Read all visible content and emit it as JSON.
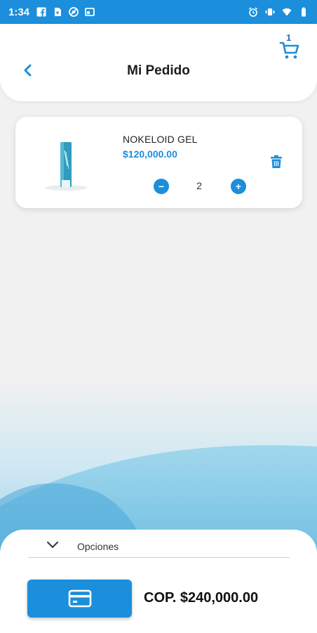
{
  "status_bar": {
    "time": "1:34",
    "left_icons": [
      "facebook-icon",
      "sim-icon",
      "vpn-icon",
      "window-icon"
    ],
    "right_icons": [
      "alarm-icon",
      "vibrate-icon",
      "wifi-icon",
      "battery-icon"
    ]
  },
  "header": {
    "title": "Mi Pedido",
    "cart_count": "1"
  },
  "product": {
    "name": "NOKELOID GEL",
    "price": "$120,000.00",
    "quantity": "2",
    "minus_label": "−",
    "plus_label": "+"
  },
  "bottom": {
    "options_label": "Opciones",
    "total": "COP. $240,000.00"
  },
  "colors": {
    "accent": "#1b8fdb",
    "background": "#f1f1f1"
  }
}
